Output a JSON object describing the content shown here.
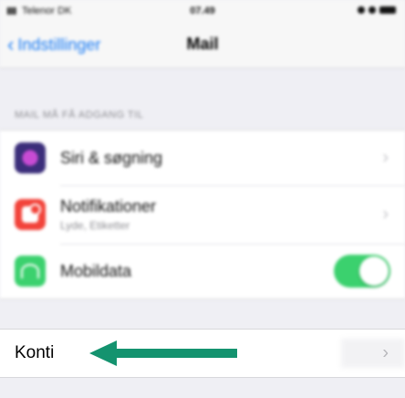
{
  "status_bar": {
    "carrier": "Telenor DK",
    "time": "07.49"
  },
  "nav": {
    "back_label": "Indstillinger",
    "title": "Mail"
  },
  "section": {
    "header": "MAIL MÅ FÅ ADGANG TIL"
  },
  "rows": [
    {
      "label": "Siri & søgning",
      "icon": "siri-icon"
    },
    {
      "label": "Notifikationer",
      "sublabel": "Lyde, Etiketter",
      "icon": "notifications-icon"
    },
    {
      "label": "Mobildata",
      "icon": "cellular-icon",
      "toggle": true
    }
  ],
  "accounts": {
    "label": "Konti"
  },
  "colors": {
    "accent_blue": "#1a7cf5",
    "toggle_green": "#3bd16e",
    "arrow_green": "#14936f"
  }
}
